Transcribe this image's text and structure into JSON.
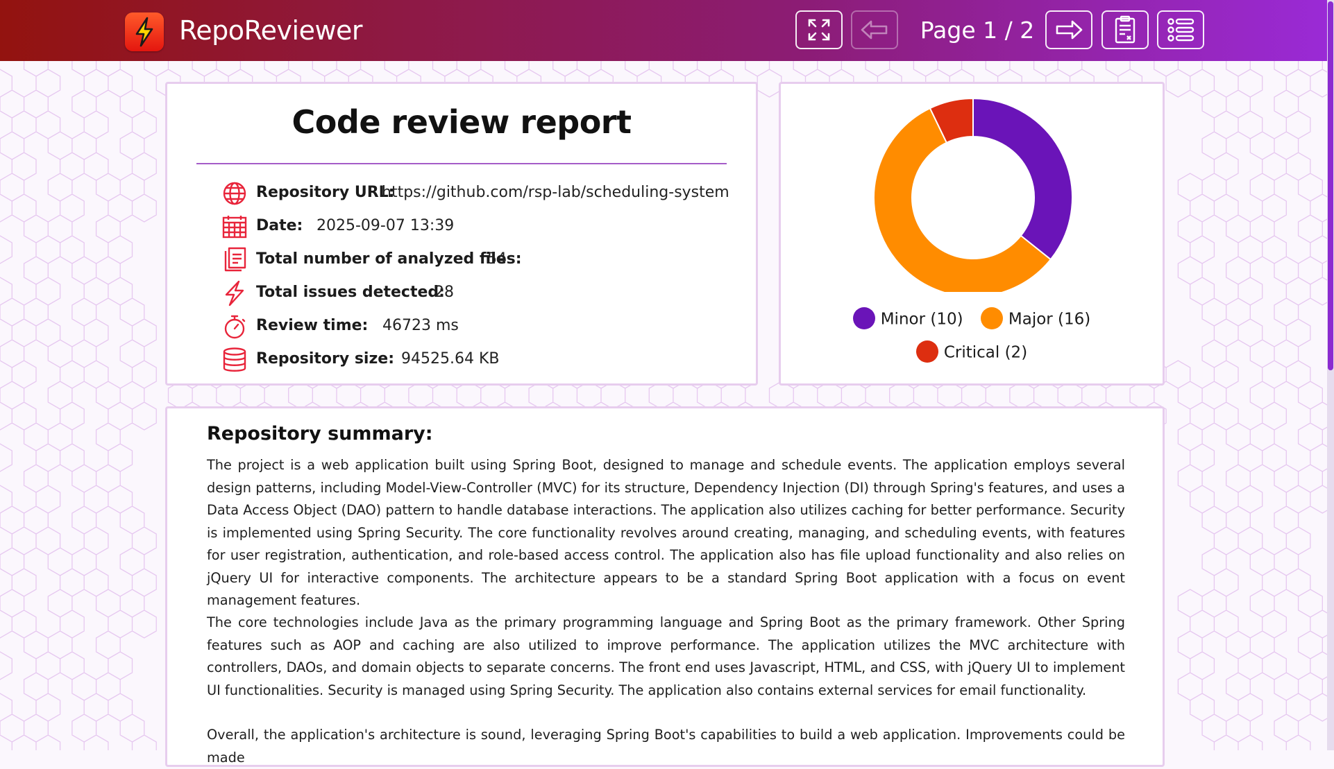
{
  "header": {
    "app_title": "RepoReviewer",
    "page_indicator": "Page 1 / 2",
    "brand_gradient": [
      "#93130f",
      "#8c1c74",
      "#9a2ad6"
    ],
    "buttons": {
      "fullscreen": "expand-icon",
      "prev": "arrow-left-icon",
      "next": "arrow-right-icon",
      "export": "report-document-icon",
      "menu": "list-menu-icon"
    }
  },
  "report": {
    "title": "Code review report",
    "rows": [
      {
        "icon": "globe-icon",
        "label": "Repository URL:",
        "value": "https://github.com/rsp-lab/scheduling-system"
      },
      {
        "icon": "calendar-icon",
        "label": "Date:",
        "value": "2025-09-07 13:39"
      },
      {
        "icon": "files-icon",
        "label": "Total number of analyzed files:",
        "value": "54"
      },
      {
        "icon": "lightning-icon",
        "label": "Total issues detected:",
        "value": "28"
      },
      {
        "icon": "stopwatch-icon",
        "label": "Review time:",
        "value": "46723 ms"
      },
      {
        "icon": "database-icon",
        "label": "Repository size:",
        "value": "94525.64 KB"
      }
    ],
    "accent_color": "#e8243a"
  },
  "chart_data": {
    "type": "pie",
    "variant": "donut",
    "categories": [
      "Minor",
      "Major",
      "Critical"
    ],
    "values": [
      10,
      16,
      2
    ],
    "colors": [
      "#6a14b8",
      "#ff8c00",
      "#dd2e10"
    ],
    "legend_labels": [
      "Minor (10)",
      "Major (16)",
      "Critical (2)"
    ],
    "legend_placement": "bottom",
    "start_angle": "top, clockwise"
  },
  "summary": {
    "heading": "Repository summary:",
    "paragraphs": [
      "The project is a web application built using Spring Boot, designed to manage and schedule events. The application employs several design patterns, including Model-View-Controller (MVC) for its structure, Dependency Injection (DI) through Spring's features, and uses a Data Access Object (DAO) pattern to handle database interactions. The application also utilizes caching for better performance. Security is implemented using Spring Security. The core functionality revolves around creating, managing, and scheduling events, with features for user registration, authentication, and role-based access control. The application also has file upload functionality and also relies on jQuery UI for interactive components. The architecture appears to be a standard Spring Boot application with a focus on event management features.",
      "The core technologies include Java as the primary programming language and Spring Boot as the primary framework. Other Spring features such as AOP and caching are also utilized to improve performance. The application utilizes the MVC architecture with controllers, DAOs, and domain objects to separate concerns. The front end uses Javascript, HTML, and CSS, with jQuery UI to implement UI functionalities. Security is managed using Spring Security. The application also contains external services for email functionality.",
      "Overall, the application's architecture is sound, leveraging Spring Boot's capabilities to build a web application. Improvements could be made"
    ]
  }
}
